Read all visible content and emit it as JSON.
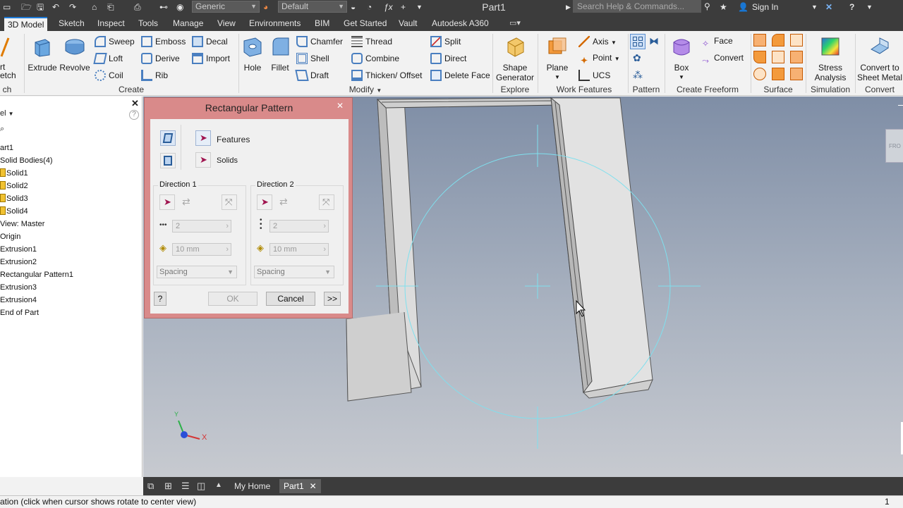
{
  "window": {
    "title": "Part1"
  },
  "quick_access": {
    "appearance_combo": "Generic",
    "material_combo": "Default"
  },
  "search": {
    "placeholder": "Search Help & Commands..."
  },
  "sign_in": "Sign In",
  "tabs": [
    {
      "label": "3D Model",
      "active": true
    },
    {
      "label": "Sketch"
    },
    {
      "label": "Inspect"
    },
    {
      "label": "Tools"
    },
    {
      "label": "Manage"
    },
    {
      "label": "View"
    },
    {
      "label": "Environments"
    },
    {
      "label": "BIM"
    },
    {
      "label": "Get Started"
    },
    {
      "label": "Vault"
    },
    {
      "label": "Autodesk A360"
    }
  ],
  "ribbon": {
    "sketch_partial": {
      "line1": "rt",
      "line2": "etch",
      "panel": "ch"
    },
    "create": {
      "panel_label": "Create",
      "extrude": "Extrude",
      "revolve": "Revolve",
      "sweep": "Sweep",
      "loft": "Loft",
      "coil": "Coil",
      "emboss": "Emboss",
      "derive": "Derive",
      "rib": "Rib",
      "decal": "Decal",
      "import": "Import"
    },
    "modify": {
      "panel_label": "Modify",
      "hole": "Hole",
      "fillet": "Fillet",
      "chamfer": "Chamfer",
      "shell": "Shell",
      "draft": "Draft",
      "thread": "Thread",
      "combine": "Combine",
      "thicken": "Thicken/ Offset",
      "split": "Split",
      "direct": "Direct",
      "delete_face": "Delete Face"
    },
    "explore": {
      "panel_label": "Explore",
      "shape_generator_1": "Shape",
      "shape_generator_2": "Generator"
    },
    "work_features": {
      "panel_label": "Work Features",
      "plane": "Plane",
      "axis": "Axis",
      "point": "Point",
      "ucs": "UCS"
    },
    "pattern": {
      "panel_label": "Pattern"
    },
    "freeform": {
      "panel_label": "Create Freeform",
      "box": "Box",
      "face": "Face",
      "convert": "Convert"
    },
    "surface": {
      "panel_label": "Surface"
    },
    "simulation": {
      "panel_label": "Simulation",
      "stress_1": "Stress",
      "stress_2": "Analysis"
    },
    "convert": {
      "panel_label": "Convert",
      "sheet_1": "Convert to",
      "sheet_2": "Sheet Metal"
    }
  },
  "browser": {
    "header": "el",
    "items": [
      {
        "label": "art1",
        "indent": 0
      },
      {
        "label": "Solid Bodies(4)",
        "indent": 0
      },
      {
        "label": "Solid1",
        "indent": 1,
        "solid": true
      },
      {
        "label": "Solid2",
        "indent": 1,
        "solid": true
      },
      {
        "label": "Solid3",
        "indent": 1,
        "solid": true
      },
      {
        "label": "Solid4",
        "indent": 1,
        "solid": true
      },
      {
        "label": "View: Master",
        "indent": 0
      },
      {
        "label": "Origin",
        "indent": 0
      },
      {
        "label": "Extrusion1",
        "indent": 0
      },
      {
        "label": "Extrusion2",
        "indent": 0
      },
      {
        "label": "Rectangular Pattern1",
        "indent": 0
      },
      {
        "label": "Extrusion3",
        "indent": 0
      },
      {
        "label": "Extrusion4",
        "indent": 0
      },
      {
        "label": "End of Part",
        "indent": 0
      }
    ]
  },
  "dialog": {
    "title": "Rectangular Pattern",
    "features_label": "Features",
    "solids_label": "Solids",
    "direction1": {
      "title": "Direction 1",
      "count": "2",
      "length": "10 mm",
      "spacing": "Spacing"
    },
    "direction2": {
      "title": "Direction 2",
      "count": "2",
      "length": "10 mm",
      "spacing": "Spacing"
    },
    "ok": "OK",
    "cancel": "Cancel",
    "more": ">>",
    "help": "?"
  },
  "viewcube_text": "FRO",
  "triad": {
    "x": "X",
    "y": "Y"
  },
  "doc_tabs": [
    {
      "label": "My Home",
      "active": false
    },
    {
      "label": "Part1",
      "active": true
    }
  ],
  "status": {
    "message": "ation (click when cursor shows rotate to center view)",
    "right": "1"
  },
  "colors": {
    "accent": "#1f7bd8",
    "dialog_frame": "#d98a8a",
    "selection_circle": "#7fe0ee"
  }
}
